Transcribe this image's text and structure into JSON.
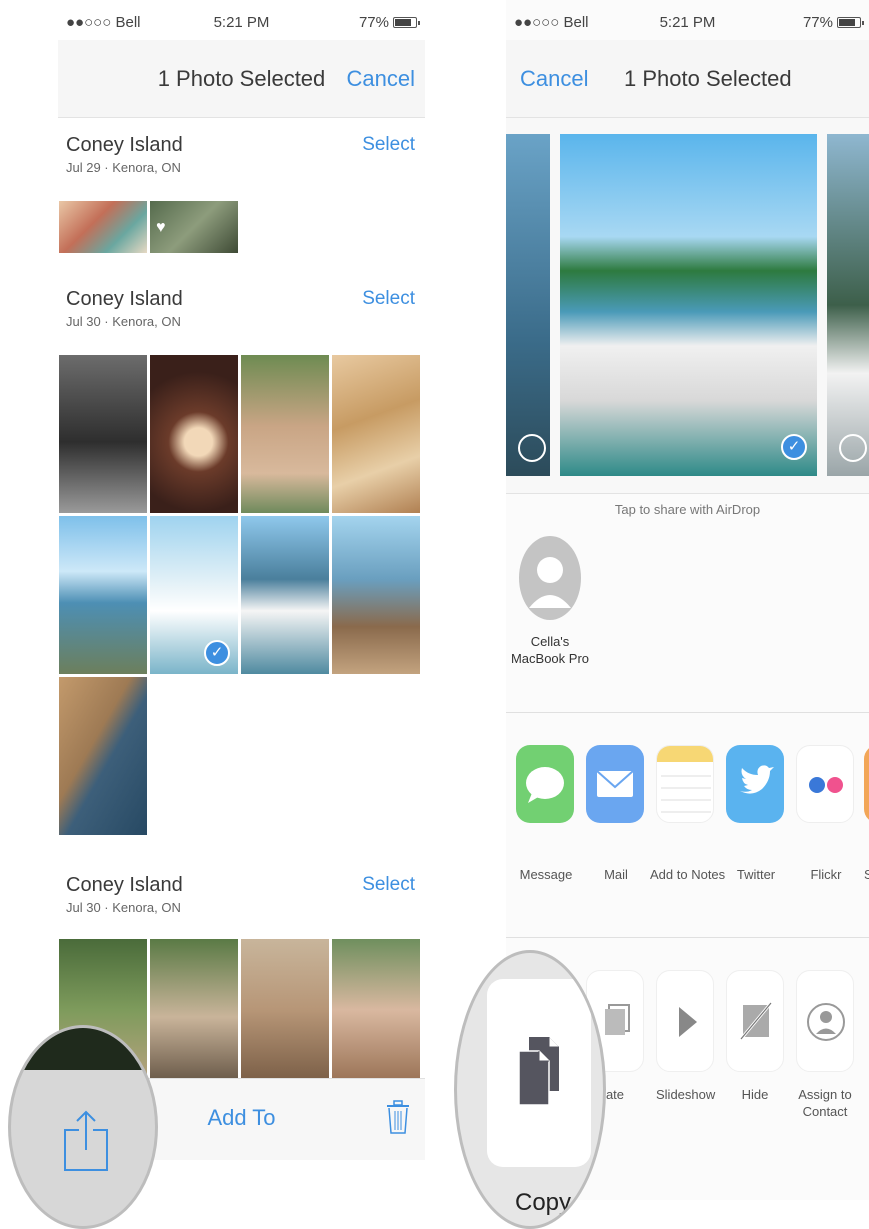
{
  "left_screen": {
    "status": {
      "carrier": "●●○○○ Bell",
      "time": "5:21 PM",
      "battery": "77%"
    },
    "nav": {
      "title": "1 Photo Selected",
      "cancel": "Cancel"
    },
    "sections": [
      {
        "name": "Coney Island",
        "sub": "Jul 29 · Kenora, ON",
        "select": "Select"
      },
      {
        "name": "Coney Island",
        "sub": "Jul 30 · Kenora, ON",
        "select": "Select"
      },
      {
        "name": "Coney Island",
        "sub": "Jul 30 · Kenora, ON",
        "select": "Select"
      }
    ],
    "toolbar": {
      "add_to": "Add To"
    }
  },
  "right_screen": {
    "status": {
      "carrier": "●●○○○ Bell",
      "time": "5:21 PM",
      "battery": "77%"
    },
    "nav": {
      "title": "1 Photo Selected",
      "cancel": "Cancel"
    },
    "airdrop_hint": "Tap to share with AirDrop",
    "device": {
      "line1": "Cella's",
      "line2": "MacBook Pro"
    },
    "apps": [
      {
        "label": "Message",
        "icon": "message-icon",
        "color": "#6fd06f"
      },
      {
        "label": "Mail",
        "icon": "mail-icon",
        "color": "#6aa6f0"
      },
      {
        "label": "Add to Notes",
        "icon": "notes-icon",
        "color": "#fff4b0"
      },
      {
        "label": "Twitter",
        "icon": "twitter-icon",
        "color": "#5ab3ef"
      },
      {
        "label": "Flickr",
        "icon": "flickr-icon",
        "color": "#ffffff"
      },
      {
        "label": "S",
        "icon": "app-icon",
        "color": "#f2a657"
      }
    ],
    "actions": [
      {
        "label": "ate",
        "icon": "duplicate-icon"
      },
      {
        "label": "Slideshow",
        "icon": "play-icon"
      },
      {
        "label": "Hide",
        "icon": "hide-icon"
      },
      {
        "label_line1": "Assign to",
        "label_line2": "Contact",
        "icon": "contact-icon"
      }
    ]
  },
  "zoom_right": {
    "label": "Copy"
  }
}
